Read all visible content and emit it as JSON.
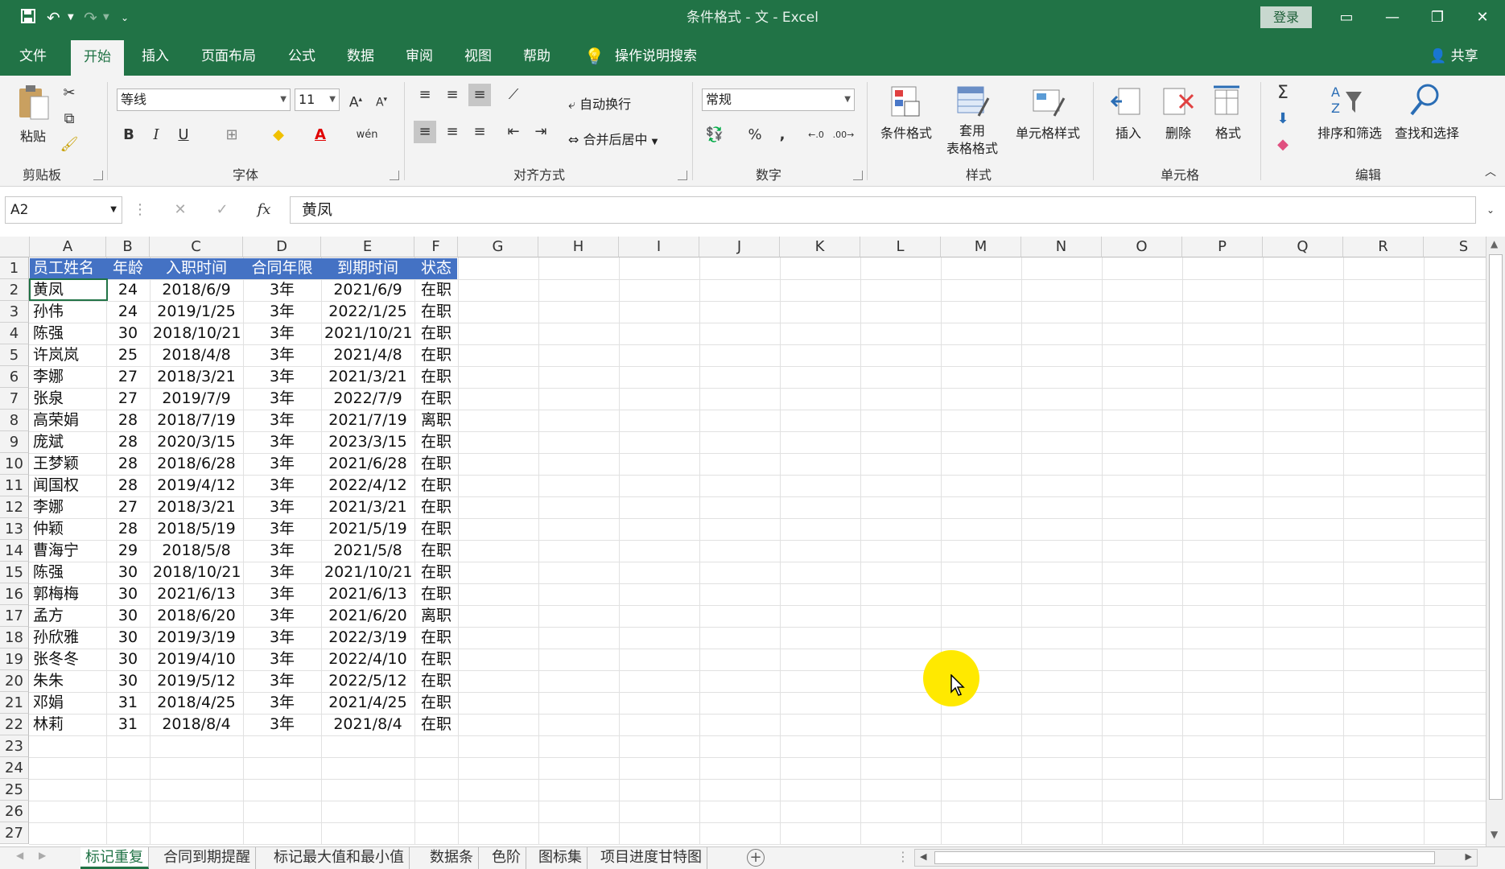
{
  "window": {
    "title": "条件格式 - 文  -  Excel",
    "login_label": "登录",
    "share_label": "共享"
  },
  "menu_tabs": [
    "文件",
    "开始",
    "插入",
    "页面布局",
    "公式",
    "数据",
    "审阅",
    "视图",
    "帮助",
    "操作说明搜索"
  ],
  "ribbon": {
    "clipboard": {
      "paste": "粘贴",
      "group": "剪贴板"
    },
    "font": {
      "name": "等线",
      "size": "11",
      "group": "字体"
    },
    "alignment": {
      "wrap": "自动换行",
      "merge": "合并后居中",
      "group": "对齐方式"
    },
    "number": {
      "format": "常规",
      "group": "数字"
    },
    "styles": {
      "cond": "条件格式",
      "table1": "套用",
      "table2": "表格格式",
      "cellstyle": "单元格样式",
      "group": "样式"
    },
    "cells": {
      "insert": "插入",
      "delete": "删除",
      "format": "格式",
      "group": "单元格"
    },
    "editing": {
      "sort": "排序和筛选",
      "find": "查找和选择",
      "group": "编辑"
    }
  },
  "formula_bar": {
    "name_box": "A2",
    "fx": "fx",
    "value": "黄凤"
  },
  "columns": [
    "A",
    "B",
    "C",
    "D",
    "E",
    "F",
    "G",
    "H",
    "I",
    "J",
    "K",
    "L",
    "M",
    "N",
    "O",
    "P",
    "Q",
    "R",
    "S"
  ],
  "rows": [
    "1",
    "2",
    "3",
    "4",
    "5",
    "6",
    "7",
    "8",
    "9",
    "10",
    "11",
    "12",
    "13",
    "14",
    "15",
    "16",
    "17",
    "18",
    "19",
    "20",
    "21",
    "22",
    "23",
    "24",
    "25",
    "26",
    "27"
  ],
  "table": {
    "headers": [
      "员工姓名",
      "年龄",
      "入职时间",
      "合同年限",
      "到期时间",
      "状态"
    ],
    "rows": [
      [
        "黄凤",
        "24",
        "2018/6/9",
        "3年",
        "2021/6/9",
        "在职"
      ],
      [
        "孙伟",
        "24",
        "2019/1/25",
        "3年",
        "2022/1/25",
        "在职"
      ],
      [
        "陈强",
        "30",
        "2018/10/21",
        "3年",
        "2021/10/21",
        "在职"
      ],
      [
        "许岚岚",
        "25",
        "2018/4/8",
        "3年",
        "2021/4/8",
        "在职"
      ],
      [
        "李娜",
        "27",
        "2018/3/21",
        "3年",
        "2021/3/21",
        "在职"
      ],
      [
        "张泉",
        "27",
        "2019/7/9",
        "3年",
        "2022/7/9",
        "在职"
      ],
      [
        "高荣娟",
        "28",
        "2018/7/19",
        "3年",
        "2021/7/19",
        "离职"
      ],
      [
        "庞斌",
        "28",
        "2020/3/15",
        "3年",
        "2023/3/15",
        "在职"
      ],
      [
        "王梦颖",
        "28",
        "2018/6/28",
        "3年",
        "2021/6/28",
        "在职"
      ],
      [
        "闻国权",
        "28",
        "2019/4/12",
        "3年",
        "2022/4/12",
        "在职"
      ],
      [
        "李娜",
        "27",
        "2018/3/21",
        "3年",
        "2021/3/21",
        "在职"
      ],
      [
        "仲颖",
        "28",
        "2018/5/19",
        "3年",
        "2021/5/19",
        "在职"
      ],
      [
        "曹海宁",
        "29",
        "2018/5/8",
        "3年",
        "2021/5/8",
        "在职"
      ],
      [
        "陈强",
        "30",
        "2018/10/21",
        "3年",
        "2021/10/21",
        "在职"
      ],
      [
        "郭梅梅",
        "30",
        "2021/6/13",
        "3年",
        "2021/6/13",
        "在职"
      ],
      [
        "孟方",
        "30",
        "2018/6/20",
        "3年",
        "2021/6/20",
        "离职"
      ],
      [
        "孙欣雅",
        "30",
        "2019/3/19",
        "3年",
        "2022/3/19",
        "在职"
      ],
      [
        "张冬冬",
        "30",
        "2019/4/10",
        "3年",
        "2022/4/10",
        "在职"
      ],
      [
        "朱朱",
        "30",
        "2019/5/12",
        "3年",
        "2022/5/12",
        "在职"
      ],
      [
        "邓娟",
        "31",
        "2018/4/25",
        "3年",
        "2021/4/25",
        "在职"
      ],
      [
        "林莉",
        "31",
        "2018/8/4",
        "3年",
        "2021/8/4",
        "在职"
      ]
    ]
  },
  "sheet_tabs": [
    "标记重复",
    "合同到期提醒",
    "标记最大值和最小值",
    "数据条",
    "色阶",
    "图标集",
    "项目进度甘特图"
  ],
  "colors": {
    "excel_green": "#217346",
    "header_fill": "#4472c4",
    "highlight": "#ffe900"
  }
}
